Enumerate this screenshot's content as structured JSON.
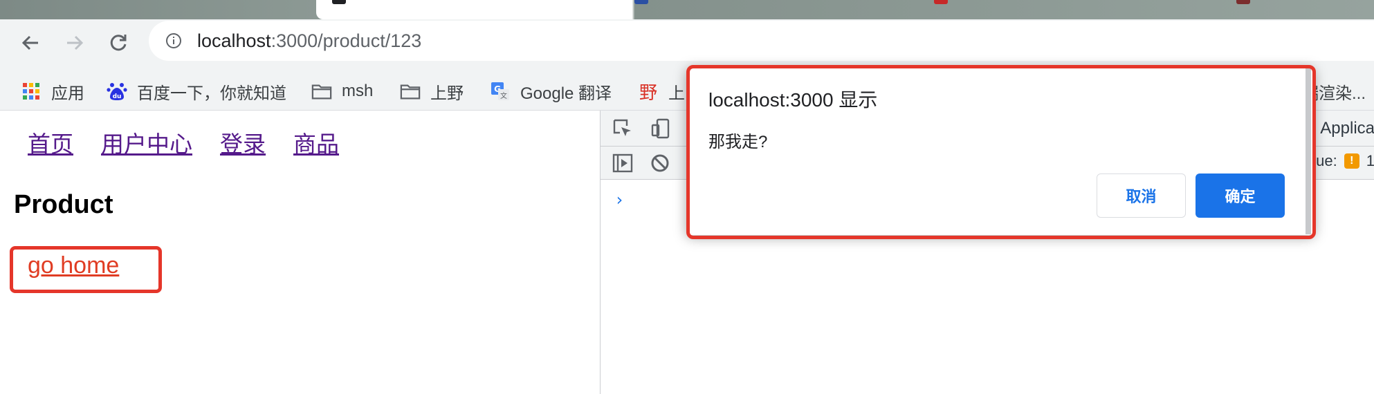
{
  "browser": {
    "url_host": "localhost",
    "url_path": ":3000/product/123"
  },
  "bookmarks": [
    {
      "label": "应用",
      "icon": "apps-grid-icon"
    },
    {
      "label": "百度一下，你就知道",
      "icon": "baidu-icon"
    },
    {
      "label": "msh",
      "icon": "folder-icon"
    },
    {
      "label": "上野",
      "icon": "folder-icon"
    },
    {
      "label": "Google 翻译",
      "icon": "google-translate-icon"
    },
    {
      "label": "上",
      "icon": "ye-icon",
      "icon_text": "野"
    },
    {
      "label": "端渲染...",
      "icon": "none"
    }
  ],
  "page": {
    "nav": [
      "首页",
      "用户中心",
      "登录",
      "商品"
    ],
    "title": "Product",
    "go_home": "go home"
  },
  "devtools": {
    "tab_partial": "Applica",
    "issue_label": "ssue:",
    "issue_count": "1",
    "prompt": "›"
  },
  "dialog": {
    "title": "localhost:3000 显示",
    "message": "那我走?",
    "cancel": "取消",
    "ok": "确定"
  },
  "colors": {
    "highlight": "#e5362a",
    "primary": "#1a73e8",
    "link_visited": "#551a8b"
  }
}
